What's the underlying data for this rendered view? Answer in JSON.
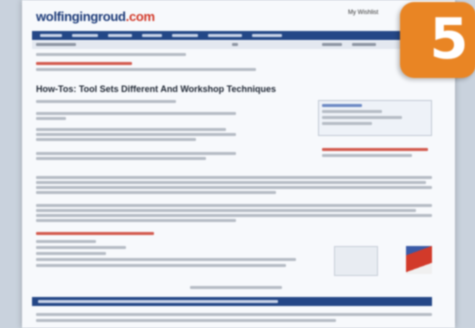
{
  "site": {
    "logo_main": "wolfingingroud",
    "logo_tld": ".com",
    "top_link": "My Wishlist"
  },
  "step_badge": {
    "number": "5"
  },
  "headline": "How-Tos: Tool Sets Different And Workshop Techniques",
  "colors": {
    "nav_bar": "#244787",
    "badge": "#e98524",
    "link_red": "#d23a2a",
    "page_bg": "#f7f9fc"
  }
}
